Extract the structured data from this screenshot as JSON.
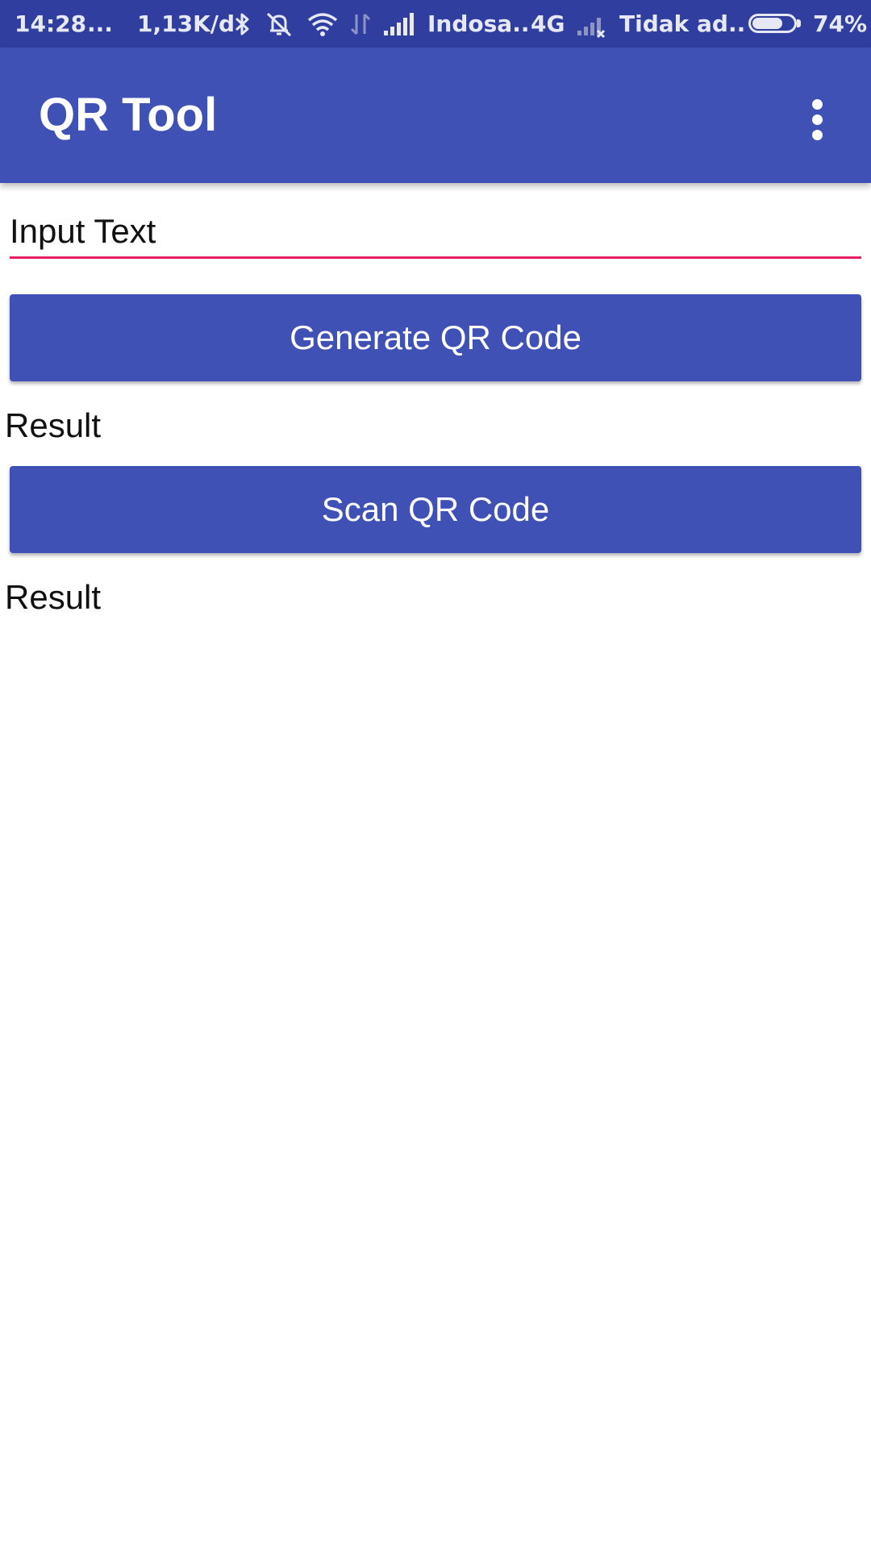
{
  "status_bar": {
    "time": "14:28",
    "more": "...",
    "speed": "1,13K/d",
    "carrier_1": "Indosa..",
    "network_type": "4G",
    "carrier_2": "Tidak ad..",
    "battery": "74%",
    "battery_level": 0.74,
    "icons": [
      "bluetooth-icon",
      "vibrate-icon",
      "wifi-icon",
      "data-arrows-icon",
      "signal-icon",
      "no-signal-icon",
      "battery-icon"
    ]
  },
  "app_bar": {
    "title": "QR Tool",
    "menu_icon": "more-vert-icon"
  },
  "main": {
    "input_placeholder": "Input Text",
    "generate_button_label": "Generate QR Code",
    "generate_result": "Result",
    "scan_button_label": "Scan QR Code",
    "scan_result": "Result"
  },
  "colors": {
    "status_bar": "#303f9f",
    "primary": "#3f51b5",
    "accent": "#e91e63",
    "text": "#111111",
    "background": "#ffffff"
  }
}
